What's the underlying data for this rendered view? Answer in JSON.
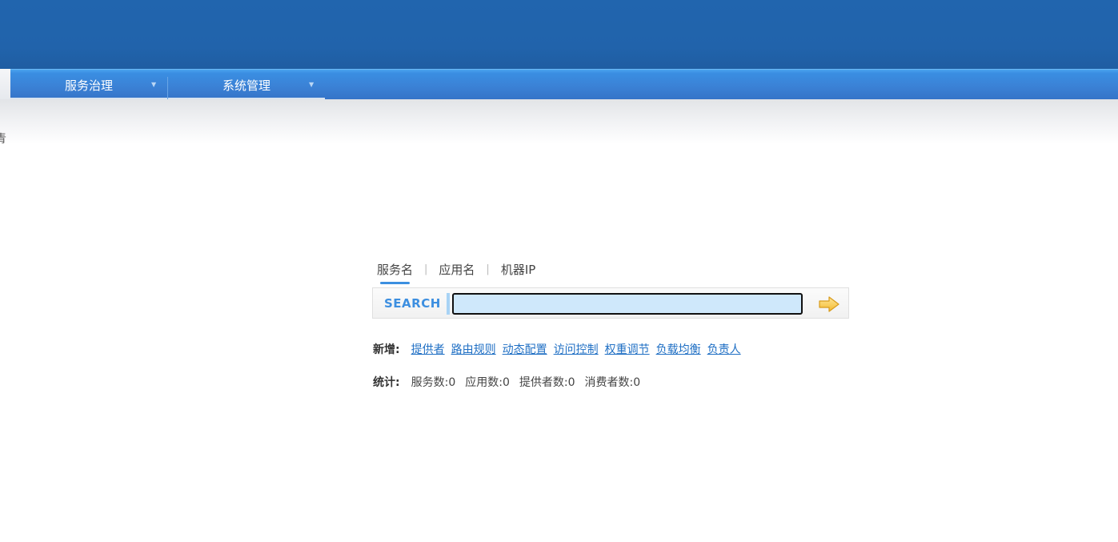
{
  "nav": {
    "items": [
      {
        "label": "服务治理"
      },
      {
        "label": "系统管理"
      }
    ],
    "edge_glyph": "青"
  },
  "search": {
    "tabs": [
      {
        "label": "服务名",
        "active": true
      },
      {
        "label": "应用名",
        "active": false
      },
      {
        "label": "机器IP",
        "active": false
      }
    ],
    "tab_separator": "|",
    "label": "SEARCH",
    "value": ""
  },
  "add": {
    "label": "新增:",
    "links": [
      "提供者",
      "路由规则",
      "动态配置",
      "访问控制",
      "权重调节",
      "负载均衡",
      "负责人"
    ]
  },
  "stats": {
    "label": "统计:",
    "items": [
      "服务数:0",
      "应用数:0",
      "提供者数:0",
      "消费者数:0"
    ]
  },
  "colors": {
    "banner": "#2163ab",
    "nav": "#3b82d6",
    "accent": "#3d8fe0",
    "link": "#1f6fc4",
    "arrow": "#f5c542"
  }
}
